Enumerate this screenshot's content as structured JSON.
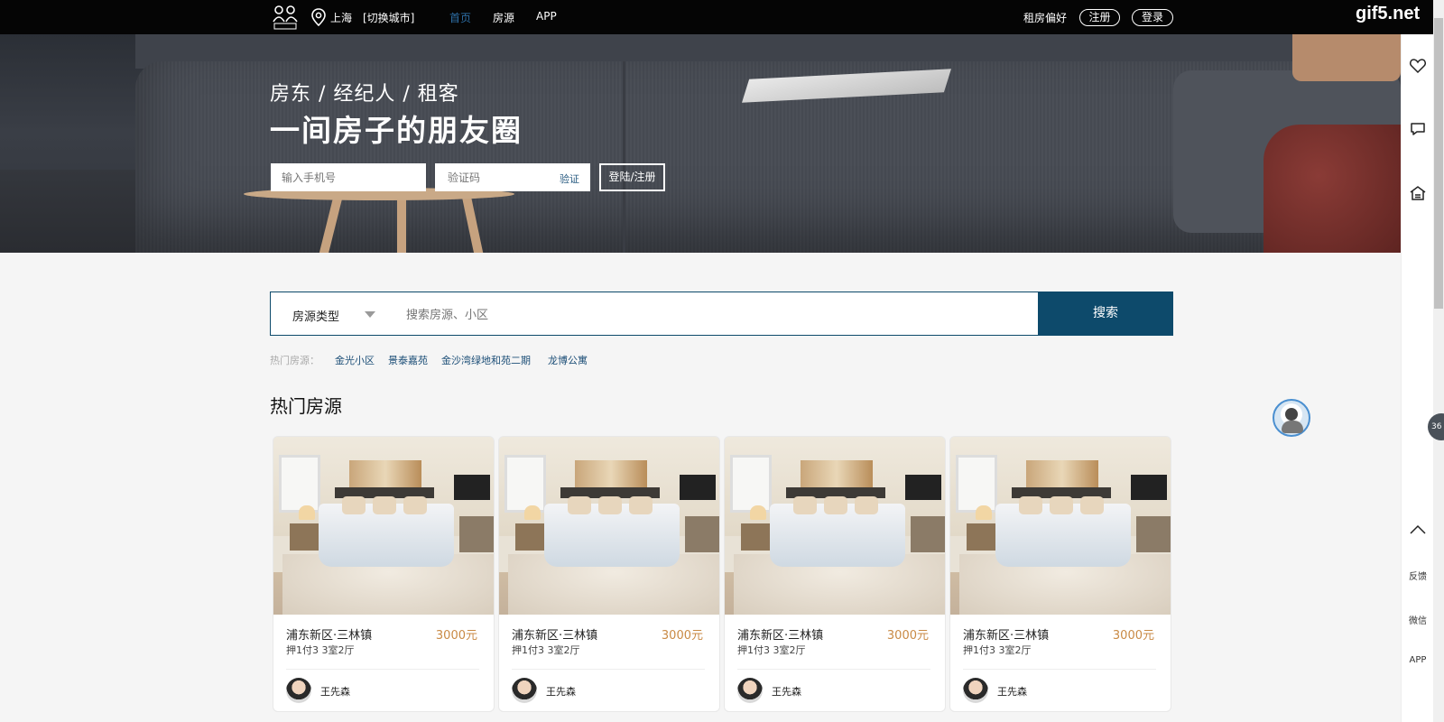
{
  "header": {
    "city": "上海",
    "switch_city": "[切换城市]",
    "nav": [
      "首页",
      "房源",
      "APP"
    ],
    "preference": "租房偏好",
    "register": "注册",
    "login": "登录",
    "watermark": "gif5.net"
  },
  "hero": {
    "subtitle": "房东 / 经纪人 / 租客",
    "title": "一间房子的朋友圈",
    "phone_placeholder": "输入手机号",
    "code_placeholder": "验证码",
    "verify": "验证",
    "login_button": "登陆/注册"
  },
  "search": {
    "type_label": "房源类型",
    "placeholder": "搜索房源、小区",
    "button": "搜索",
    "hot_label": "热门房源：",
    "hot_links": [
      "金光小区",
      "景泰嘉苑",
      "金沙湾绿地和苑二期",
      "龙博公寓"
    ]
  },
  "section_title": "热门房源",
  "listings": [
    {
      "area": "浦东新区·三林镇",
      "price": "3000元",
      "terms": "押1付3   3室2厅",
      "agent": "王先森"
    },
    {
      "area": "浦东新区·三林镇",
      "price": "3000元",
      "terms": "押1付3   3室2厅",
      "agent": "王先森"
    },
    {
      "area": "浦东新区·三林镇",
      "price": "3000元",
      "terms": "押1付3   3室2厅",
      "agent": "王先森"
    },
    {
      "area": "浦东新区·三林镇",
      "price": "3000元",
      "terms": "押1付3   3室2厅",
      "agent": "王先森"
    }
  ],
  "sidebar": {
    "icons": [
      "heart-icon",
      "chat-icon",
      "house-icon",
      "chevron-up-icon"
    ],
    "feedback": "反馈",
    "wechat": "微信",
    "app": "APP"
  },
  "float_badge": "36"
}
